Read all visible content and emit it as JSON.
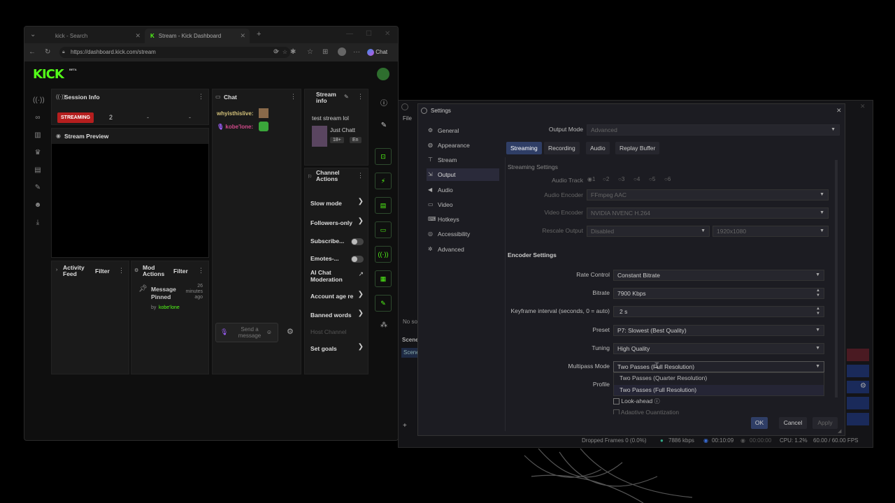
{
  "browser": {
    "tabs": [
      {
        "label": "kick - Search"
      },
      {
        "label": "Stream - Kick Dashboard"
      }
    ],
    "url": "https://dashboard.kick.com/stream",
    "chat_button": "Chat"
  },
  "kick": {
    "logo": "KICK",
    "beta": "BETA",
    "session_info": {
      "title": "Session Info",
      "status": "STREAMING",
      "viewers": "2",
      "dash1": "-",
      "dash2": "-"
    },
    "stream_preview": {
      "title": "Stream Preview"
    },
    "activity_feed": {
      "title": "Activity Feed",
      "filter": "Filter"
    },
    "mod_actions": {
      "title": "Mod Actions",
      "filter": "Filter",
      "item_title": "Message Pinned",
      "item_time": "26 minutes ago",
      "item_by": "by",
      "item_user": "kobe'lone"
    },
    "chat": {
      "title": "Chat",
      "messages": [
        {
          "user": "whyisthislive:"
        },
        {
          "user": "kobe'lone:"
        }
      ],
      "placeholder": "Send a message"
    },
    "stream_info": {
      "title": "Stream info",
      "stream_title": "test stream lol",
      "category": "Just Chatt",
      "badge": "18+",
      "lang": "En"
    },
    "channel_actions": {
      "title": "Channel Actions",
      "items": [
        {
          "label": "Slow mode"
        },
        {
          "label": "Followers-only"
        },
        {
          "label": "Subscribe..."
        },
        {
          "label": "Emotes-..."
        },
        {
          "label": "AI Chat Moderation"
        },
        {
          "label": "Account age re"
        },
        {
          "label": "Banned words"
        },
        {
          "label": "Host Channel"
        },
        {
          "label": "Set goals"
        }
      ]
    }
  },
  "obs": {
    "menu_file": "File",
    "no_source": "No so",
    "scenes": "Scene",
    "scene_item": "Scene",
    "status": {
      "dropped": "Dropped Frames 0 (0.0%)",
      "kbps": "7886 kbps",
      "time1": "00:10:09",
      "time2": "00:00:00",
      "cpu": "CPU: 1.2%",
      "fps": "60.00 / 60.00 FPS"
    }
  },
  "settings": {
    "title": "Settings",
    "nav": [
      "General",
      "Appearance",
      "Stream",
      "Output",
      "Audio",
      "Video",
      "Hotkeys",
      "Accessibility",
      "Advanced"
    ],
    "output_mode_label": "Output Mode",
    "output_mode_value": "Advanced",
    "tabs": [
      "Streaming",
      "Recording",
      "Audio",
      "Replay Buffer"
    ],
    "streaming_settings": "Streaming Settings",
    "audio_track_label": "Audio Track",
    "audio_tracks": [
      "1",
      "2",
      "3",
      "4",
      "5",
      "6"
    ],
    "audio_encoder_label": "Audio Encoder",
    "audio_encoder_value": "FFmpeg AAC",
    "video_encoder_label": "Video Encoder",
    "video_encoder_value": "NVIDIA NVENC H.264",
    "rescale_label": "Rescale Output",
    "rescale_value": "Disabled",
    "rescale_res": "1920x1080",
    "encoder_settings": "Encoder Settings",
    "rate_control_label": "Rate Control",
    "rate_control_value": "Constant Bitrate",
    "bitrate_label": "Bitrate",
    "bitrate_value": "7900 Kbps",
    "keyframe_label": "Keyframe interval (seconds, 0 = auto)",
    "keyframe_value": "2 s",
    "preset_label": "Preset",
    "preset_value": "P7: Slowest (Best Quality)",
    "tuning_label": "Tuning",
    "tuning_value": "High Quality",
    "multipass_label": "Multipass Mode",
    "multipass_value": "Two Passes (Full Resolution)",
    "multipass_options": [
      "Two Passes (Quarter Resolution)",
      "Two Passes (Full Resolution)"
    ],
    "profile_label": "Profile",
    "lookahead_label": "Look-ahead",
    "adaptive_label": "Adaptive Quantization",
    "ok": "OK",
    "cancel": "Cancel",
    "apply": "Apply"
  }
}
